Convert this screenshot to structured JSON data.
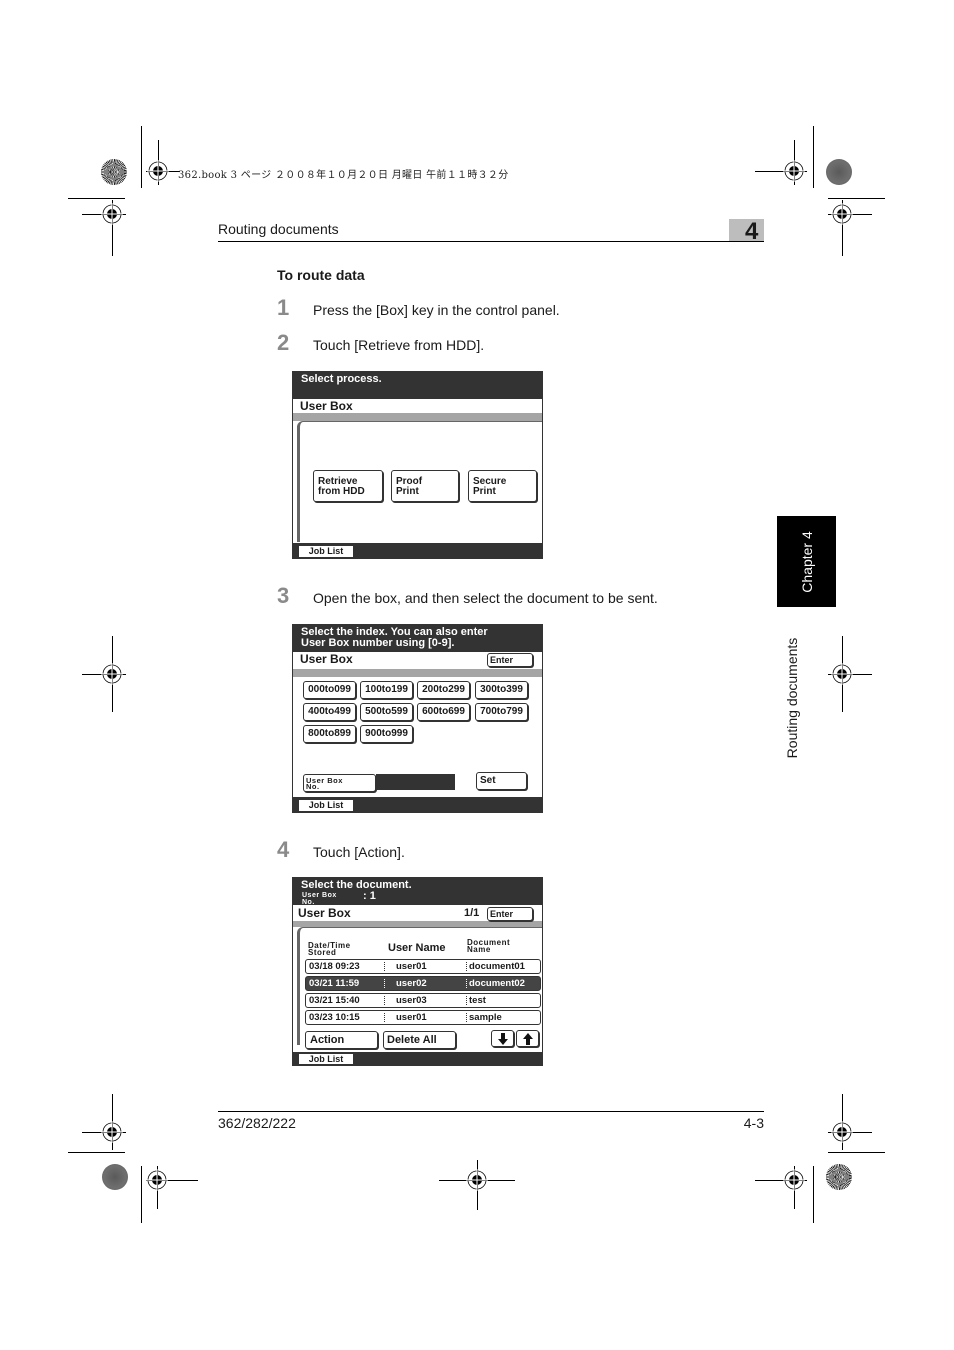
{
  "print_meta": "362.book  3 ページ  ２００８年１０月２０日  月曜日  午前１１時３２分",
  "header": {
    "running_title": "Routing documents",
    "chapter_number": "4"
  },
  "side_tab": {
    "chapter_label": "Chapter 4",
    "section_label": "Routing documents"
  },
  "section_title": "To route data",
  "steps": [
    {
      "number": "1",
      "text": "Press the [Box] key in the control panel."
    },
    {
      "number": "2",
      "text": "Touch [Retrieve from HDD]."
    },
    {
      "number": "3",
      "text": "Open the box, and then select the document to be sent."
    },
    {
      "number": "4",
      "text": "Touch [Action]."
    }
  ],
  "screen1": {
    "title": "Select process.",
    "bar_label": "User Box",
    "buttons": [
      {
        "line1": "Retrieve",
        "line2": "from HDD"
      },
      {
        "line1": "Proof",
        "line2": "Print"
      },
      {
        "line1": "Secure",
        "line2": "Print"
      }
    ],
    "job_list": "Job List"
  },
  "screen2": {
    "title_line1": "Select the index. You can also enter",
    "title_line2": "User Box number using [0-9].",
    "bar_label": "User Box",
    "enter": "Enter",
    "index_buttons": [
      "000to099",
      "100to199",
      "200to299",
      "300to399",
      "400to499",
      "500to599",
      "600to699",
      "700to799",
      "800to899",
      "900to999"
    ],
    "user_box_no_line1": "User Box",
    "user_box_no_line2": "No.",
    "set": "Set",
    "job_list": "Job List"
  },
  "screen3": {
    "title": "Select the document.",
    "userbox_label_line1": "User Box",
    "userbox_label_line2": "No.",
    "userbox_value": ": 1",
    "bar_label": "User Box",
    "page": "1/1",
    "enter": "Enter",
    "columns": {
      "date_line1": "Date/Time",
      "date_line2": "Stored",
      "user": "User Name",
      "doc_line1": "Document",
      "doc_line2": "Name"
    },
    "rows": [
      {
        "date": "03/18 09:23",
        "user": "user01",
        "doc": "document01",
        "selected": false
      },
      {
        "date": "03/21 11:59",
        "user": "user02",
        "doc": "document02",
        "selected": true
      },
      {
        "date": "03/21 15:40",
        "user": "user03",
        "doc": "test",
        "selected": false
      },
      {
        "date": "03/23 10:15",
        "user": "user01",
        "doc": "sample",
        "selected": false
      }
    ],
    "action": "Action",
    "delete_all": "Delete All",
    "down_icon": "arrow-down-icon",
    "up_icon": "arrow-up-icon",
    "job_list": "Job List"
  },
  "footer": {
    "model": "362/282/222",
    "page": "4-3"
  }
}
